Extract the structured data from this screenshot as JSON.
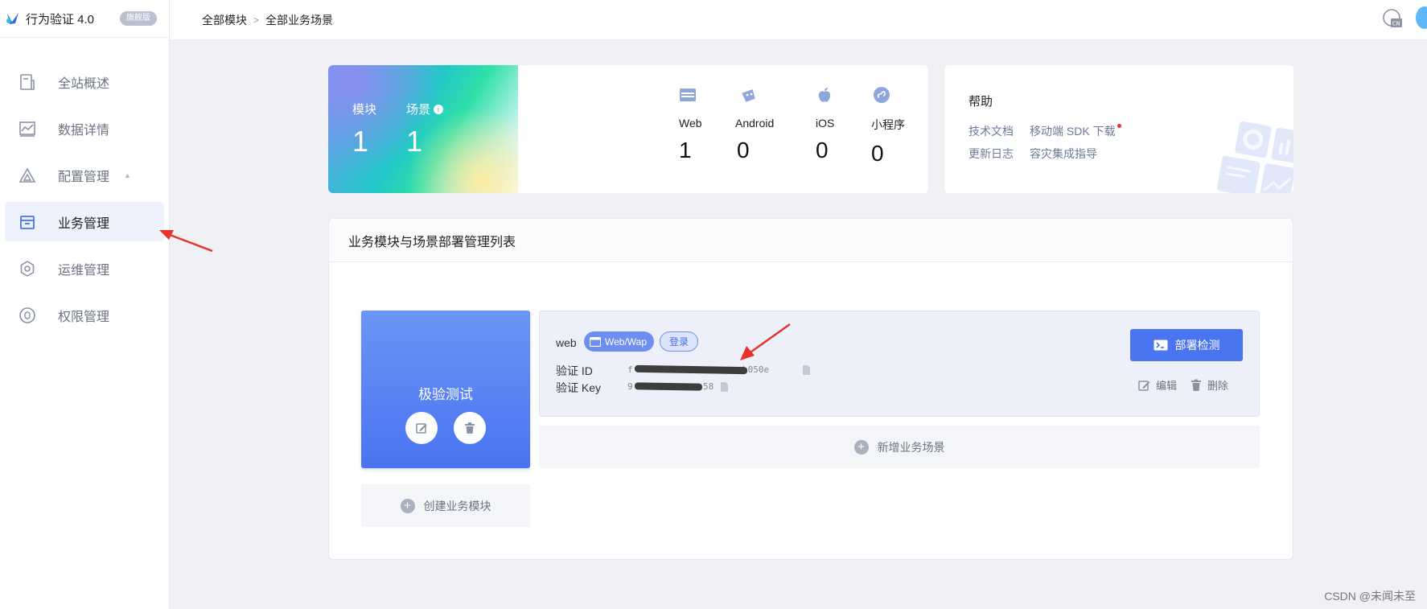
{
  "app": {
    "name": "行为验证 4.0",
    "edition": "旗舰版"
  },
  "sidebar": {
    "items": [
      {
        "label": "全站概述",
        "icon": "overview-icon"
      },
      {
        "label": "数据详情",
        "icon": "chart-icon"
      },
      {
        "label": "配置管理",
        "icon": "config-icon"
      },
      {
        "label": "业务管理",
        "icon": "business-icon"
      },
      {
        "label": "运维管理",
        "icon": "settings-icon"
      },
      {
        "label": "权限管理",
        "icon": "permission-icon"
      }
    ],
    "active_index": 3
  },
  "breadcrumb": {
    "root": "全部模块",
    "separator": ">",
    "current": "全部业务场景"
  },
  "stats": {
    "module_label": "模块",
    "module_count": "1",
    "scene_label": "场景",
    "scene_count": "1",
    "platforms": [
      {
        "name": "Web",
        "count": "1",
        "icon": "web-icon"
      },
      {
        "name": "Android",
        "count": "0",
        "icon": "android-icon"
      },
      {
        "name": "iOS",
        "count": "0",
        "icon": "apple-icon"
      },
      {
        "name": "小程序",
        "count": "0",
        "icon": "miniprogram-icon"
      }
    ]
  },
  "help": {
    "title": "帮助",
    "links": [
      "技术文档",
      "移动端 SDK 下载",
      "更新日志",
      "容灾集成指导"
    ]
  },
  "panel": {
    "title": "业务模块与场景部署管理列表",
    "module": {
      "name": "极验测试"
    },
    "create_module_label": "创建业务模块",
    "scene": {
      "name": "web",
      "platform_tag": "Web/Wap",
      "type_tag": "登录",
      "id_label": "验证 ID",
      "id_visible_start": "f",
      "id_visible_end": "b050e",
      "key_label": "验证 Key",
      "key_visible_start": "9",
      "key_visible_end": "58",
      "deploy_label": "部署检测",
      "edit_label": "编辑",
      "delete_label": "删除"
    },
    "add_scene_label": "新增业务场景"
  },
  "watermark": "CSDN @未闻未至",
  "colors": {
    "primary": "#4a74f0",
    "sidebar_active": "#eef2fc",
    "annotation_arrow": "#e8322b"
  }
}
